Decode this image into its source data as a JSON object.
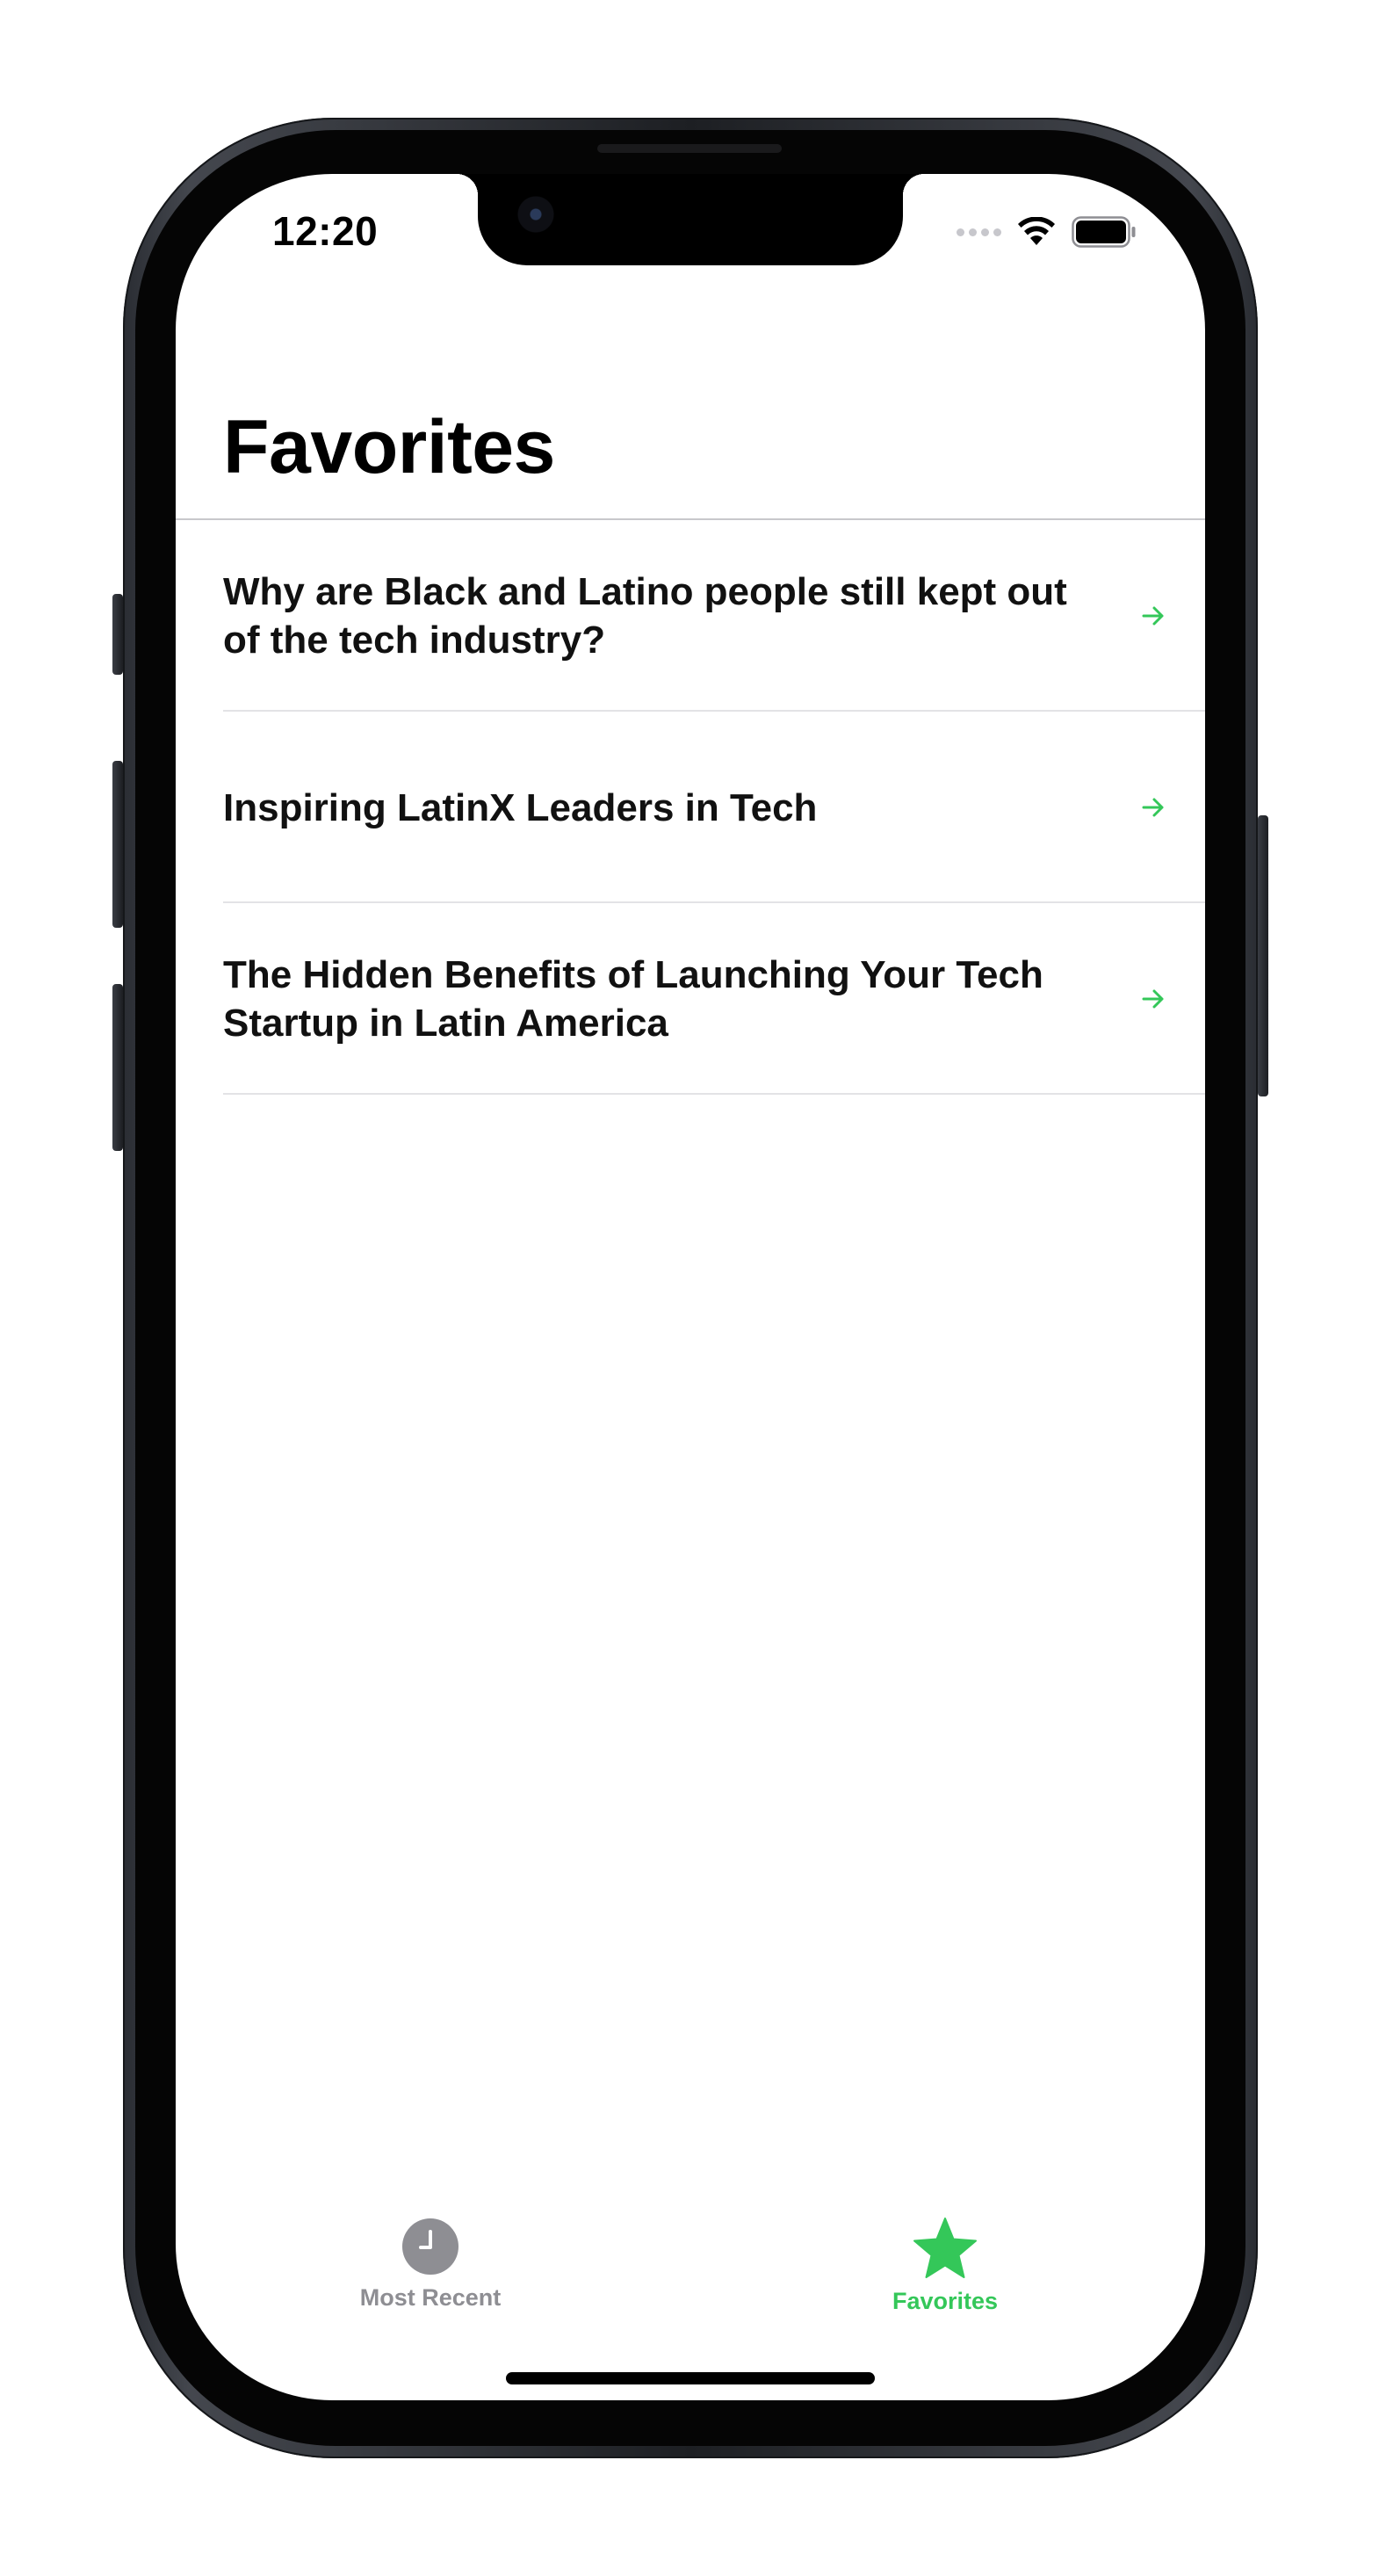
{
  "colors": {
    "accent": "#34c759",
    "inactive": "#8e8e93",
    "text": "#000000"
  },
  "status_bar": {
    "time": "12:20",
    "icons": [
      "cellular-signal-icon",
      "wifi-icon",
      "battery-icon"
    ]
  },
  "page": {
    "title": "Favorites"
  },
  "articles": [
    {
      "title": "Why are Black and Latino people still kept out of the tech industry?",
      "icon": "arrow-right-icon"
    },
    {
      "title": "Inspiring LatinX Leaders in Tech",
      "icon": "arrow-right-icon"
    },
    {
      "title": "The Hidden Benefits of Launching Your Tech Startup in Latin America",
      "icon": "arrow-right-icon"
    }
  ],
  "tabbar": {
    "tabs": [
      {
        "label": "Most Recent",
        "icon": "clock-icon",
        "selected": false
      },
      {
        "label": "Favorites",
        "icon": "star-icon",
        "selected": true
      }
    ]
  }
}
